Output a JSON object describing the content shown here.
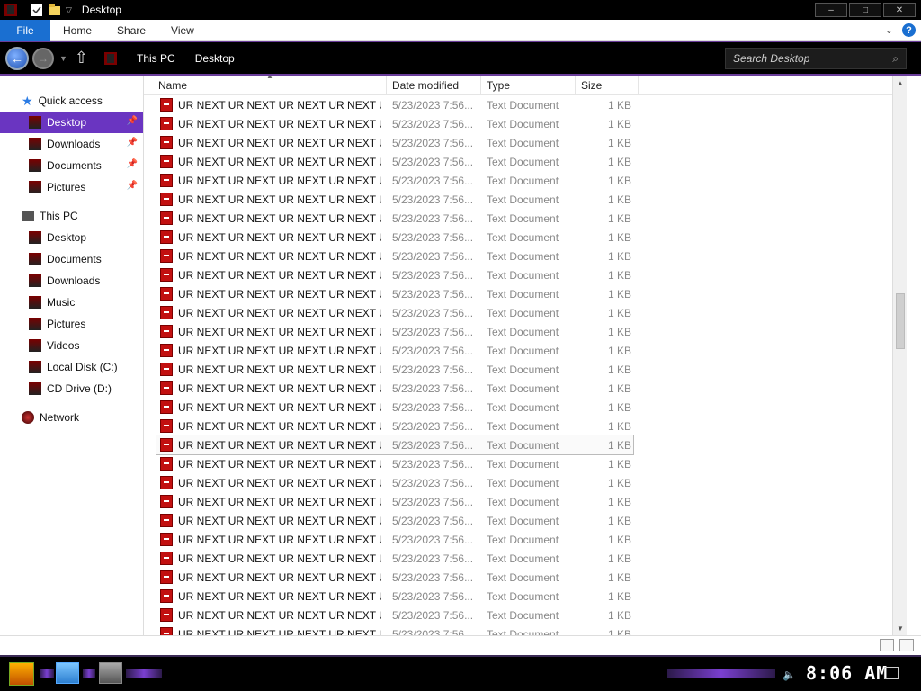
{
  "window": {
    "title": "Desktop",
    "buttons": {
      "minimize": "–",
      "maximize": "□",
      "close": "✕"
    }
  },
  "ribbon": {
    "tabs": [
      "File",
      "Home",
      "Share",
      "View"
    ],
    "help": "?"
  },
  "address": {
    "crumbs": [
      "This PC",
      "Desktop"
    ],
    "search_placeholder": "Search Desktop"
  },
  "sidebar": {
    "quick_access": {
      "label": "Quick access",
      "items": [
        {
          "label": "Desktop",
          "pinned": true,
          "selected": true
        },
        {
          "label": "Downloads",
          "pinned": true
        },
        {
          "label": "Documents",
          "pinned": true
        },
        {
          "label": "Pictures",
          "pinned": true
        }
      ]
    },
    "this_pc": {
      "label": "This PC",
      "items": [
        {
          "label": "Desktop"
        },
        {
          "label": "Documents"
        },
        {
          "label": "Downloads"
        },
        {
          "label": "Music"
        },
        {
          "label": "Pictures"
        },
        {
          "label": "Videos"
        },
        {
          "label": "Local Disk (C:)"
        },
        {
          "label": "CD Drive (D:)"
        }
      ]
    },
    "network": {
      "label": "Network"
    }
  },
  "columns": [
    "Name",
    "Date modified",
    "Type",
    "Size"
  ],
  "files": {
    "name": "UR NEXT UR NEXT UR NEXT UR NEXT UR NE...",
    "date": "5/23/2023 7:56...",
    "type": "Text Document",
    "size": "1 KB",
    "visible_rows": 29,
    "hovered_row": 18
  },
  "taskbar": {
    "clock": "8:06 AM"
  },
  "colors": {
    "accent": "#6a35c1",
    "file_tab": "#1a6fd1",
    "file_icon": "#c21010"
  }
}
